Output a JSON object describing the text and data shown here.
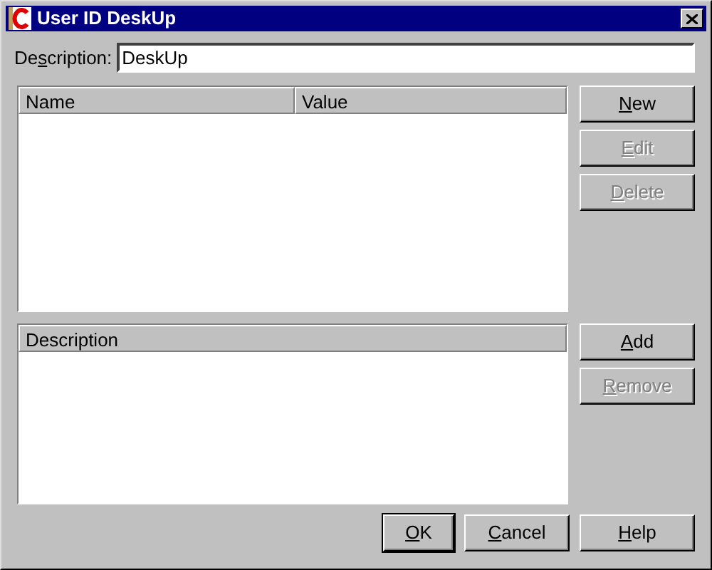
{
  "window": {
    "title": "User ID DeskUp"
  },
  "description": {
    "label": {
      "pre": "De",
      "key": "s",
      "post": "cription:"
    },
    "value": "DeskUp"
  },
  "properties_table": {
    "columns": [
      "Name",
      "Value"
    ]
  },
  "properties_buttons": [
    {
      "label": {
        "key": "N",
        "post": "ew"
      },
      "disabled": false
    },
    {
      "label": {
        "key": "E",
        "post": "dit"
      },
      "disabled": true
    },
    {
      "label": {
        "key": "D",
        "post": "elete"
      },
      "disabled": true
    }
  ],
  "description_table": {
    "columns": [
      "Description"
    ]
  },
  "description_buttons": [
    {
      "label": {
        "key": "A",
        "post": "dd"
      },
      "disabled": false
    },
    {
      "label": {
        "key": "R",
        "post": "emove"
      },
      "disabled": true
    }
  ],
  "dialog_buttons": [
    {
      "label": {
        "key": "O",
        "post": "K"
      },
      "default": true
    },
    {
      "label": {
        "key": "C",
        "post": "ancel"
      },
      "default": false
    },
    {
      "label": {
        "key": "H",
        "post": "elp"
      },
      "default": false
    }
  ]
}
